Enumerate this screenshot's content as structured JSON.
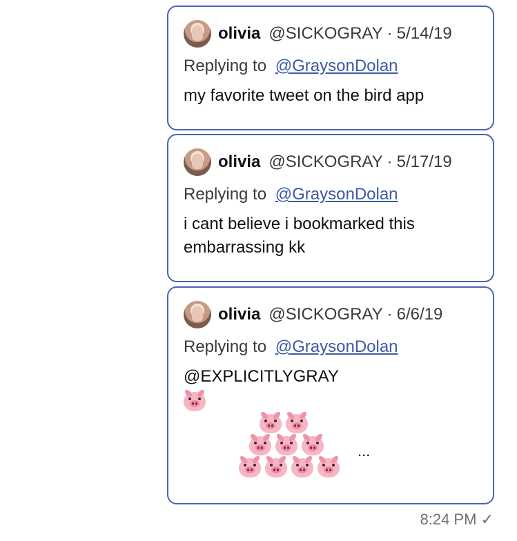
{
  "tweets": [
    {
      "name": "olivia",
      "handle": "@SICKOGRAY",
      "date": "5/14/19",
      "replying_prefix": "Replying to",
      "replying_to": "@GraysonDolan",
      "text": "my favorite tweet on the bird app"
    },
    {
      "name": "olivia",
      "handle": "@SICKOGRAY",
      "date": "5/17/19",
      "replying_prefix": "Replying to",
      "replying_to": "@GraysonDolan",
      "text": "i cant believe i bookmarked this\nembarrassing kk"
    },
    {
      "name": "olivia",
      "handle": "@SICKOGRAY",
      "date": "6/6/19",
      "replying_prefix": "Replying to",
      "replying_to": "@GraysonDolan",
      "text": "@EXPLICITLYGRAY",
      "emoji_rows": [
        1,
        2,
        3,
        4
      ],
      "emoji_name": "pig-face-icon",
      "ellipsis": "..."
    }
  ],
  "message": {
    "time": "8:24 PM",
    "status": "✓"
  },
  "colors": {
    "border": "#4a63b8",
    "link": "#3c5aa6",
    "pig": "#f6b6c4"
  }
}
